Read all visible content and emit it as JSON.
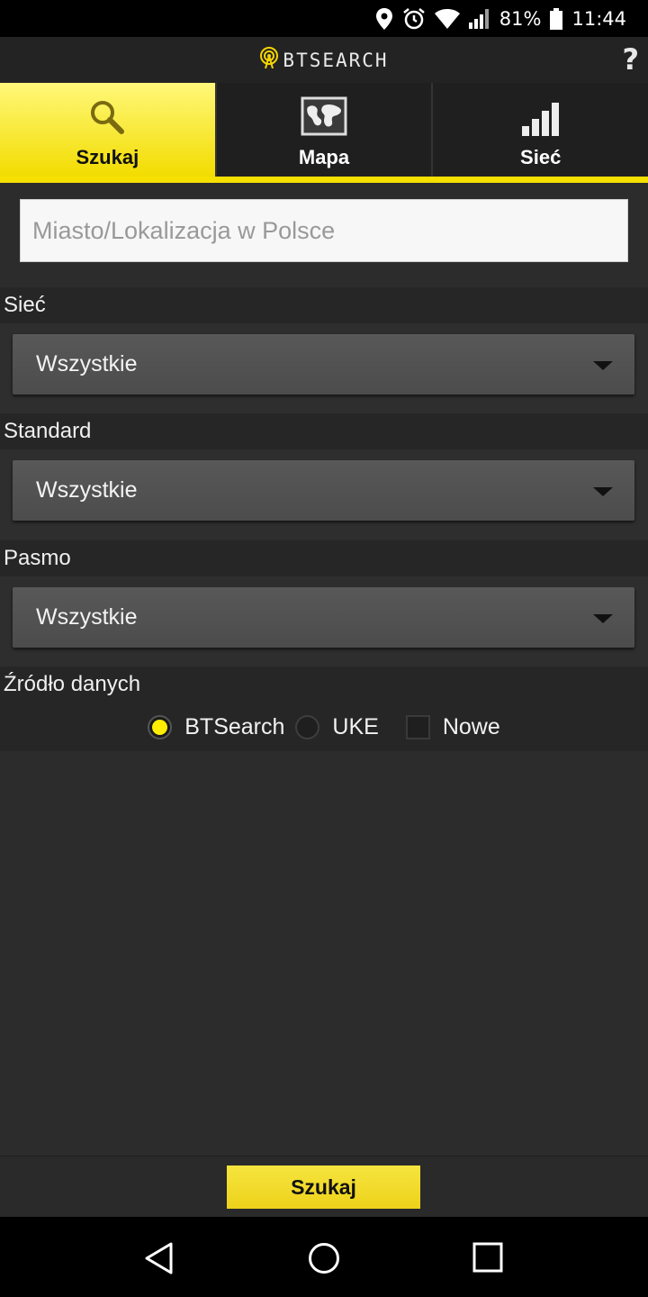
{
  "status_bar": {
    "battery": "81%",
    "time": "11:44",
    "icons": [
      "location-icon",
      "alarm-icon",
      "wifi-icon",
      "signal-icon",
      "battery-icon"
    ]
  },
  "app_bar": {
    "logo_text": "BTSEARCH",
    "help_label": "?"
  },
  "tabs": [
    {
      "label": "Szukaj",
      "icon": "search-icon",
      "active": true
    },
    {
      "label": "Mapa",
      "icon": "map-icon",
      "active": false
    },
    {
      "label": "Sieć",
      "icon": "signal-bars-icon",
      "active": false
    }
  ],
  "search": {
    "placeholder": "Miasto/Lokalizacja w Polsce",
    "value": ""
  },
  "filters": {
    "network": {
      "label": "Sieć",
      "selected": "Wszystkie"
    },
    "standard": {
      "label": "Standard",
      "selected": "Wszystkie"
    },
    "band": {
      "label": "Pasmo",
      "selected": "Wszystkie"
    }
  },
  "data_source": {
    "label": "Źródło danych",
    "options": [
      {
        "label": "BTSearch",
        "type": "radio",
        "checked": true
      },
      {
        "label": "UKE",
        "type": "radio",
        "checked": false
      },
      {
        "label": "Nowe",
        "type": "checkbox",
        "checked": false
      }
    ]
  },
  "search_button": {
    "label": "Szukaj"
  },
  "colors": {
    "accent": "#f6e000",
    "background": "#2c2c2c",
    "appbar": "#232323"
  }
}
